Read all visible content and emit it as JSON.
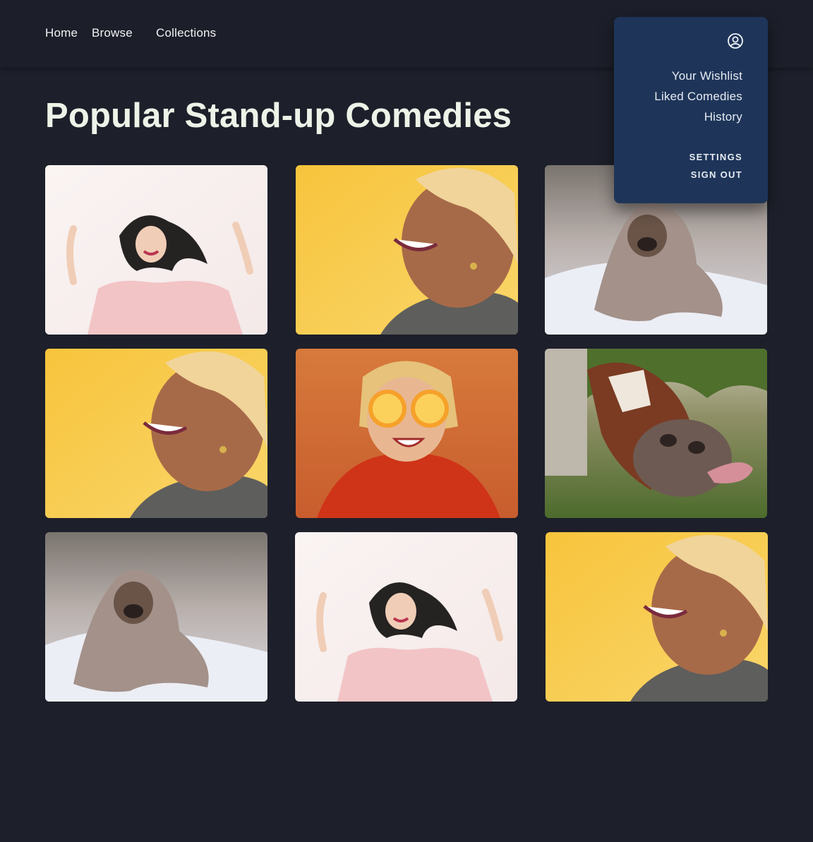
{
  "nav": {
    "home": "Home",
    "browse": "Browse",
    "collections": "Collections"
  },
  "page": {
    "title": "Popular Stand-up Comedies"
  },
  "menu": {
    "icon": "user-circle-icon",
    "items": [
      "Your Wishlist",
      "Liked Comedies",
      "History"
    ],
    "settings": "SETTINGS",
    "sign_out": "SIGN OUT"
  },
  "grid": {
    "photos": [
      "woman-pink-sweater-laughing",
      "woman-blonde-laughing-yellow",
      "pug-in-blanket",
      "woman-blonde-laughing-yellow",
      "woman-orange-slices-eyes",
      "cow-tongue-out",
      "pug-in-blanket",
      "woman-pink-sweater-laughing",
      "woman-blonde-laughing-yellow"
    ]
  },
  "colors": {
    "background": "#1d1f2a",
    "navbar": "#1c1e29",
    "dropdown": "#1e3559",
    "title": "#eef3e8"
  }
}
